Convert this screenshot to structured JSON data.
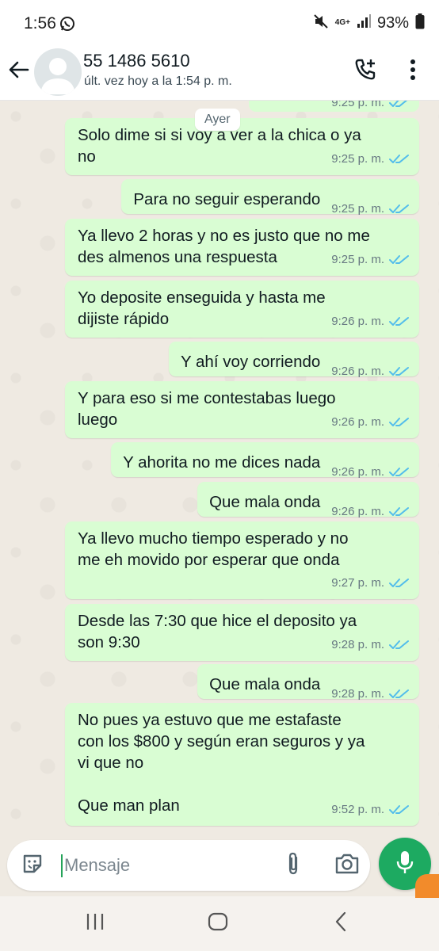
{
  "status_bar": {
    "time": "1:56",
    "network": "4G+",
    "battery": "93%"
  },
  "header": {
    "contact_name": "55 1486 5610",
    "last_seen": "últ. vez hoy a la 1:54 p. m."
  },
  "chat": {
    "date_chip": "Ayer",
    "partial_top_time": "9:25 p. m.",
    "messages": [
      {
        "text": "Solo dime si si voy a ver a la chica o ya\nno",
        "time": "9:25 p. m.",
        "status": "read"
      },
      {
        "text": "Para no seguir esperando",
        "time": "9:25 p. m.",
        "status": "read"
      },
      {
        "text": "Ya llevo 2 horas y no es justo que no me\ndes almenos una respuesta",
        "time": "9:25 p. m.",
        "status": "read"
      },
      {
        "text": "Yo deposite enseguida y hasta me\ndijiste rápido",
        "time": "9:26 p. m.",
        "status": "read"
      },
      {
        "text": "Y ahí voy corriendo",
        "time": "9:26 p. m.",
        "status": "read"
      },
      {
        "text": "Y para eso si me contestabas luego\nluego",
        "time": "9:26 p. m.",
        "status": "read"
      },
      {
        "text": "Y ahorita no me dices nada",
        "time": "9:26 p. m.",
        "status": "read"
      },
      {
        "text": "Que mala onda",
        "time": "9:26 p. m.",
        "status": "read"
      },
      {
        "text": "Ya llevo mucho tiempo esperado y no\nme eh movido por esperar que onda",
        "time": "9:27 p. m.",
        "status": "read"
      },
      {
        "text": "Desde las 7:30 que hice el deposito ya\nson 9:30",
        "time": "9:28 p. m.",
        "status": "read"
      },
      {
        "text": "Que mala onda",
        "time": "9:28 p. m.",
        "status": "read"
      },
      {
        "text": "No pues ya estuvo que me estafaste\ncon los $800 y según eran seguros y ya\nvi que no\n\nQue man plan",
        "time": "9:52 p. m.",
        "status": "read"
      }
    ]
  },
  "composer": {
    "placeholder": "Mensaje"
  },
  "colors": {
    "bubble_outgoing": "#d9fdd3",
    "chat_background": "#efeae2",
    "read_ticks": "#53bdeb",
    "mic_button": "#1daa61"
  },
  "icons": {
    "header": [
      "back-arrow-icon",
      "avatar-placeholder-icon",
      "add-call-icon",
      "more-vert-icon"
    ],
    "composer": [
      "sticker-icon",
      "paperclip-icon",
      "camera-icon",
      "mic-icon"
    ],
    "nav": [
      "recent-apps-icon",
      "home-icon",
      "back-icon"
    ]
  }
}
